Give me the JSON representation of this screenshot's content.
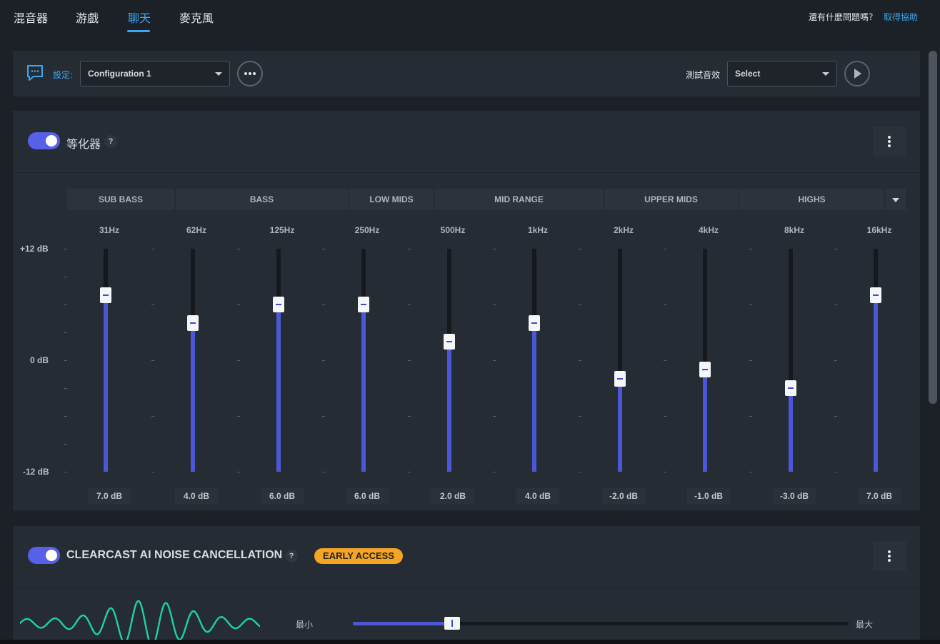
{
  "nav": {
    "tabs": [
      {
        "label": "混音器"
      },
      {
        "label": "游戲"
      },
      {
        "label": "聊天",
        "active": true
      },
      {
        "label": "麥克風"
      }
    ],
    "help_text": "還有什麼問題嗎？",
    "help_link": "取得協助",
    "accent_color": "#3ba7f0"
  },
  "config": {
    "icon": "chat-bubble-icon",
    "label": "設定:",
    "selected": "Configuration 1",
    "more_icon": "more-horizontal-icon",
    "test_label": "測試音效",
    "test_select": "Select",
    "play_icon": "play-icon"
  },
  "eq": {
    "enabled": true,
    "title": "等化器",
    "help": "?",
    "menu_icon": "kebab-menu-icon",
    "bands": [
      "SUB BASS",
      "BASS",
      "LOW MIDS",
      "MID RANGE",
      "UPPER MIDS",
      "HIGHS"
    ],
    "band_dropdown_icon": "caret-down-icon",
    "axis": {
      "top": "+12 dB",
      "mid": "0 dB",
      "bottom": "-12 dB"
    },
    "range_db": [
      -12,
      12
    ],
    "sliders": [
      {
        "freq": "31Hz",
        "value_db": 7,
        "label": "7.0 dB"
      },
      {
        "freq": "62Hz",
        "value_db": 4,
        "label": "4.0 dB"
      },
      {
        "freq": "125Hz",
        "value_db": 6,
        "label": "6.0 dB"
      },
      {
        "freq": "250Hz",
        "value_db": 6,
        "label": "6.0 dB"
      },
      {
        "freq": "500Hz",
        "value_db": 2,
        "label": "2.0 dB"
      },
      {
        "freq": "1kHz",
        "value_db": 4,
        "label": "4.0 dB"
      },
      {
        "freq": "2kHz",
        "value_db": -2,
        "label": "-2.0 dB"
      },
      {
        "freq": "4kHz",
        "value_db": -1,
        "label": "-1.0 dB"
      },
      {
        "freq": "8kHz",
        "value_db": -3,
        "label": "-3.0 dB"
      },
      {
        "freq": "16kHz",
        "value_db": 7,
        "label": "7.0 dB"
      }
    ],
    "fill_color": "#4b57d8"
  },
  "noise": {
    "enabled": true,
    "title": "CLEARCAST AI NOISE CANCELLATION",
    "help": "?",
    "badge": "EARLY ACCESS",
    "badge_color": "#f5a524",
    "menu_icon": "kebab-menu-icon",
    "waveform_icon": "waveform-icon",
    "waveform_color": "#1fd1a5",
    "min_label": "最小",
    "max_label": "最大",
    "level": 0.2
  }
}
